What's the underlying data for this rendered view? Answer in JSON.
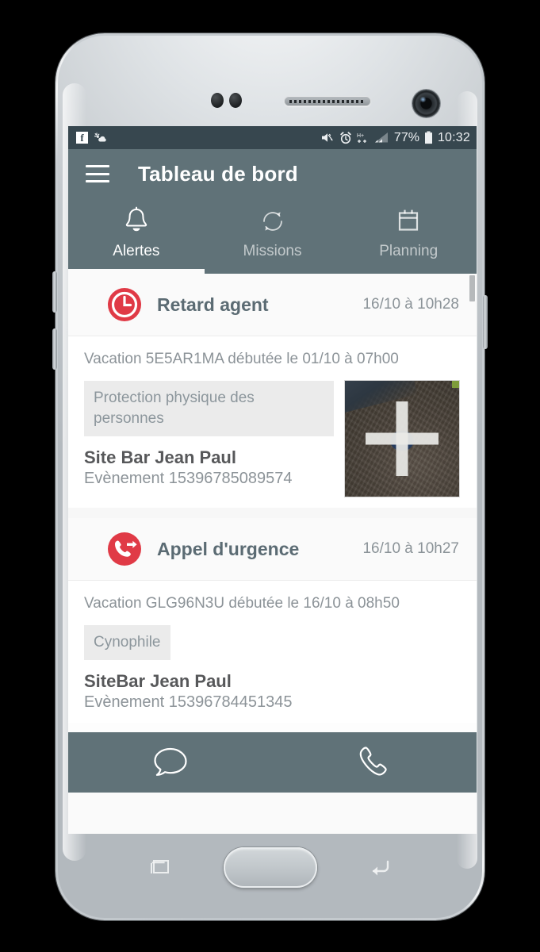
{
  "statusbar": {
    "icons_left": [
      "facebook-icon",
      "weather-icon"
    ],
    "icons_right": [
      "mute-vibrate-icon",
      "alarm-icon",
      "hplus-network-icon",
      "signal-icon",
      "battery-icon"
    ],
    "facebook_glyph": "f",
    "network_label": "H+",
    "battery_percent": "77%",
    "clock": "10:32"
  },
  "appbar": {
    "menu_icon": "hamburger-menu-icon",
    "title": "Tableau de bord",
    "bg_color": "#607278"
  },
  "tabs": [
    {
      "label": "Alertes",
      "icon": "bell-icon",
      "active": true
    },
    {
      "label": "Missions",
      "icon": "refresh-icon",
      "active": false
    },
    {
      "label": "Planning",
      "icon": "calendar-icon",
      "active": false
    }
  ],
  "alerts": [
    {
      "icon": "clock-alert-icon",
      "icon_color": "#e03a46",
      "title": "Retard agent",
      "time": "16/10 à 10h28",
      "vacation": "Vacation 5E5AR1MA débutée le 01/10 à 07h00",
      "chip": "Protection physique des personnes",
      "site": "Site Bar Jean Paul",
      "event": "Evènement 15396785089574",
      "has_map": true,
      "map_marker": "cross-marker-icon"
    },
    {
      "icon": "emergency-call-icon",
      "icon_color": "#e03a46",
      "title": "Appel d'urgence",
      "time": "16/10 à 10h27",
      "vacation": "Vacation GLG96N3U débutée le 16/10 à 08h50",
      "chip": "Cynophile",
      "site": "SiteBar Jean Paul",
      "event": "Evènement 15396784451345",
      "has_map": false,
      "map_marker": ""
    }
  ],
  "bottombar": {
    "chat_icon": "chat-bubble-icon",
    "call_icon": "phone-handset-icon"
  },
  "device": {
    "nav_recents_icon": "recents-icon",
    "nav_home_icon": "home-button",
    "nav_back_icon": "back-arrow-icon"
  }
}
